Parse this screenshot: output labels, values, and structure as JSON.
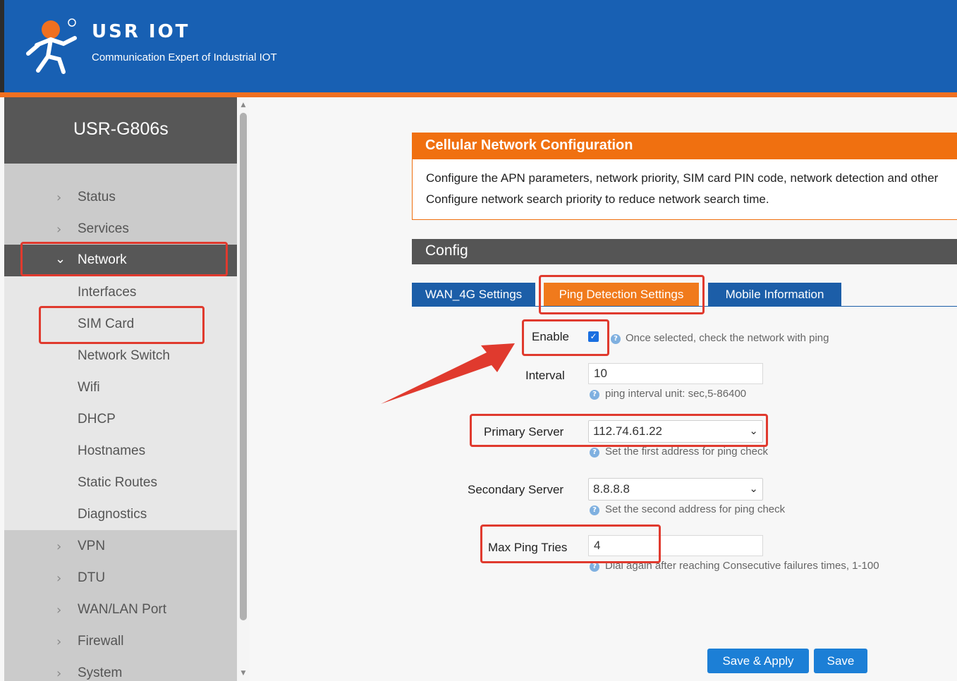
{
  "header": {
    "brand": "USR IOT",
    "tagline": "Communication Expert of Industrial IOT",
    "logo_icon": "usr-iot-logo-icon"
  },
  "sidebar": {
    "device_name": "USR-G806s",
    "items": [
      {
        "label": "Status"
      },
      {
        "label": "Services"
      },
      {
        "label": "Network"
      },
      {
        "label": "VPN"
      },
      {
        "label": "DTU"
      },
      {
        "label": "WAN/LAN Port"
      },
      {
        "label": "Firewall"
      },
      {
        "label": "System"
      }
    ],
    "network_sub": [
      {
        "label": "Interfaces"
      },
      {
        "label": "SIM Card"
      },
      {
        "label": "Network Switch"
      },
      {
        "label": "Wifi"
      },
      {
        "label": "DHCP"
      },
      {
        "label": "Hostnames"
      },
      {
        "label": "Static Routes"
      },
      {
        "label": "Diagnostics"
      }
    ]
  },
  "card": {
    "title": "Cellular Network Configuration",
    "line1": "Configure the APN parameters, network priority, SIM card PIN code, network detection and other",
    "line2": "Configure network search priority to reduce network search time."
  },
  "config": {
    "title": "Config",
    "tabs": [
      {
        "label": "WAN_4G Settings"
      },
      {
        "label": "Ping Detection Settings"
      },
      {
        "label": "Mobile Information"
      }
    ]
  },
  "form": {
    "enable_label": "Enable",
    "enable_checked": true,
    "enable_help": "Once selected, check the network with ping",
    "interval_label": "Interval",
    "interval_value": "10",
    "interval_help": "ping interval unit: sec,5-86400",
    "primary_label": "Primary Server",
    "primary_value": "112.74.61.22",
    "primary_help": "Set the first address for ping check",
    "secondary_label": "Secondary Server",
    "secondary_value": "8.8.8.8",
    "secondary_help": "Set the second address for ping check",
    "maxping_label": "Max Ping Tries",
    "maxping_value": "4",
    "maxping_help": "Dial again after reaching Consecutive failures times, 1-100"
  },
  "buttons": {
    "save_apply": "Save & Apply",
    "save": "Save"
  },
  "colors": {
    "header_blue": "#1860b3",
    "accent_orange": "#f07010",
    "annotation_red": "#e03a2e"
  }
}
